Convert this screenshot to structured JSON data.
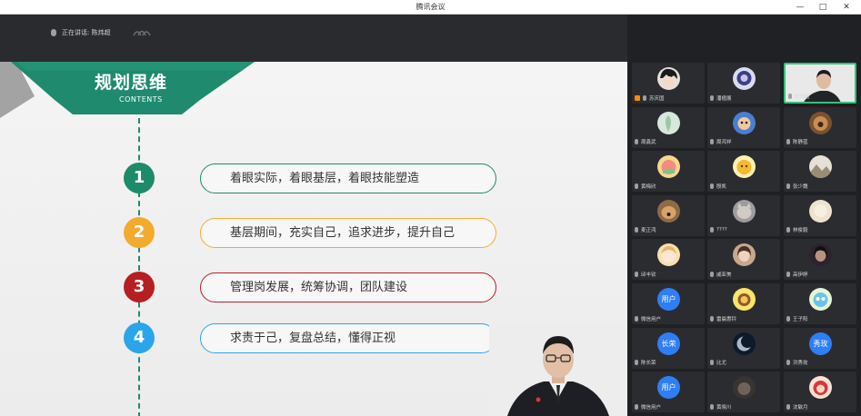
{
  "window": {
    "title": "腾讯会议",
    "controls": {
      "minimize": "—",
      "maximize": "□",
      "close": "✕"
    }
  },
  "topbar": {
    "speaking_label": "正在讲话: 陈炜超",
    "icons": [
      "microphone-icon",
      "signal-icon"
    ]
  },
  "slide": {
    "title": "规划思维",
    "subtitle": "CONTENTS",
    "items": [
      {
        "number": "1",
        "text": "着眼实际，着眼基层，着眼技能塑造",
        "color": "#1d8a6a"
      },
      {
        "number": "2",
        "text": "基层期间，充实自己，追求进步，提升自己",
        "color": "#f3ab2e"
      },
      {
        "number": "3",
        "text": "管理岗发展，统筹协调，团队建设",
        "color": "#b61f22"
      },
      {
        "number": "4",
        "text": "求责于己，复盘总结，懂得正视",
        "color": "#2aa5ea"
      }
    ],
    "colors": {
      "banner": "#1f8a6e",
      "banner_shadow": "#9a9a9a"
    }
  },
  "participants": [
    {
      "name": "苏庆国",
      "avatar": "anime-face",
      "orange": true
    },
    {
      "name": "潘楹展",
      "avatar": "game-character"
    },
    {
      "name": "陈炜超",
      "avatar": "live-video",
      "active": true
    },
    {
      "name": "周鑫武",
      "avatar": "plant"
    },
    {
      "name": "周鸿祥",
      "avatar": "cartoon-blue"
    },
    {
      "name": "陈静蓝",
      "avatar": "curly-dog"
    },
    {
      "name": "黄梅欣",
      "avatar": "cartoon-cake"
    },
    {
      "name": "殷凯",
      "avatar": "yellow-toy"
    },
    {
      "name": "张少魏",
      "avatar": "landscape"
    },
    {
      "name": "麦正鸿",
      "avatar": "dog"
    },
    {
      "name": "????",
      "avatar": "cat"
    },
    {
      "name": "林俊毅",
      "avatar": "soft-light"
    },
    {
      "name": "邱丰钦",
      "avatar": "cartoon-girl"
    },
    {
      "name": "戚亚美",
      "avatar": "girl-photo"
    },
    {
      "name": "高伊婷",
      "avatar": "dark-portrait"
    },
    {
      "name": "微信用户",
      "avatar_text": "用户"
    },
    {
      "name": "雷晨惠钤",
      "avatar": "yellow-cartoon"
    },
    {
      "name": "王子阳",
      "avatar": "colorful-cartoon"
    },
    {
      "name": "陈长荣",
      "avatar_text": "长荣"
    },
    {
      "name": "比尤",
      "avatar": "moon"
    },
    {
      "name": "洪秀玫",
      "avatar_text": "秀玫"
    },
    {
      "name": "微信用户",
      "avatar_text": "用户"
    },
    {
      "name": "黄晓川",
      "avatar": "dark-photo"
    },
    {
      "name": "沈敏月",
      "avatar": "red-cartoon"
    }
  ]
}
